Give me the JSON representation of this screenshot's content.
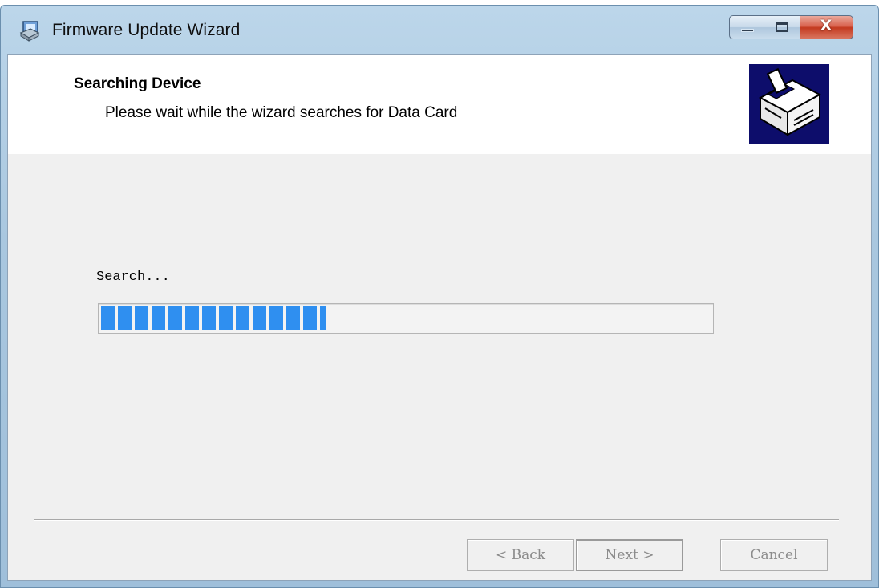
{
  "window": {
    "title": "Firmware Update Wizard",
    "controls": {
      "minimize": "minimize",
      "maximize": "maximize",
      "close": "X"
    }
  },
  "header": {
    "title": "Searching Device",
    "subtitle": "Please wait while the wizard searches for Data Card",
    "image_icon": "computer-hardware-icon"
  },
  "progress": {
    "label": "Search...",
    "value_percent": 37
  },
  "buttons": {
    "back": "< Back",
    "next": "Next >",
    "cancel": "Cancel"
  },
  "colors": {
    "progress_fill": "#2f8ff0",
    "titlebar": "#a9c7df",
    "client_background": "#f0f0f0",
    "header_image_background": "#0d0d6b",
    "close_button": "#c3391f"
  }
}
